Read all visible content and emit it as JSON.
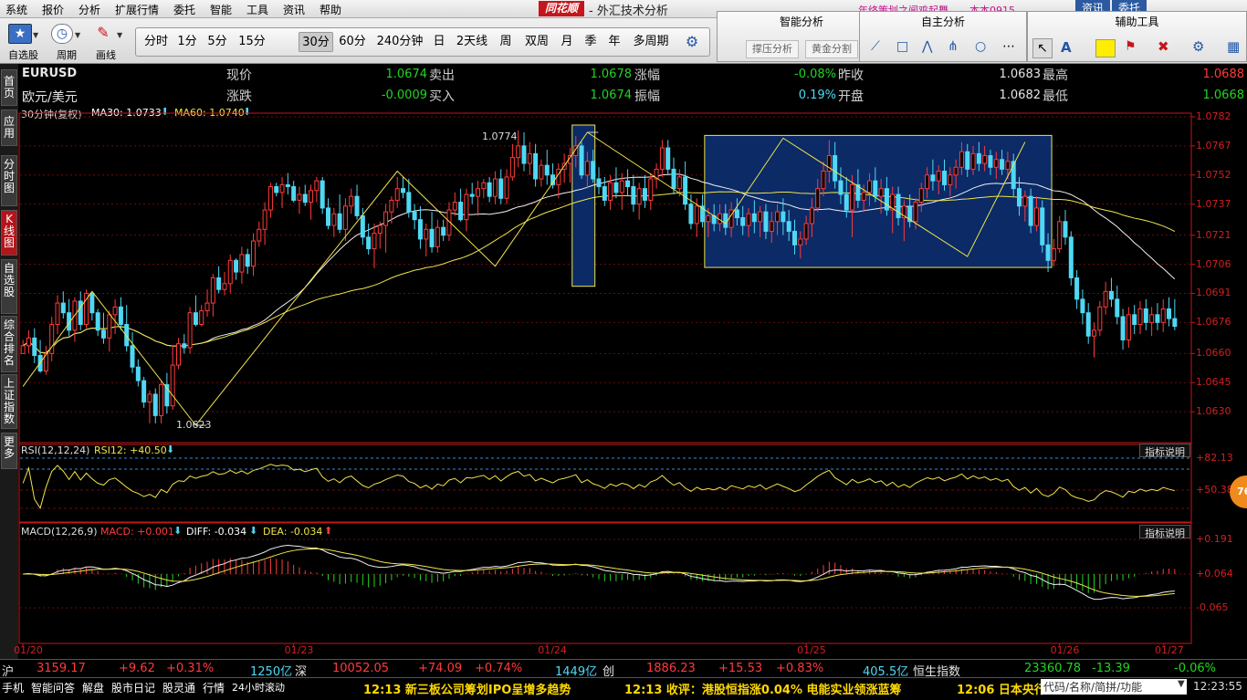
{
  "menubar": {
    "items": [
      "系统",
      "报价",
      "分析",
      "扩展行情",
      "委托",
      "智能",
      "工具",
      "资讯",
      "帮助"
    ],
    "logo": "同花顺",
    "title": "- 外汇技术分析",
    "marquee": "年终策划之闻鸡起舞",
    "user": "本本0915",
    "btn_news": "资讯",
    "btn_trade": "委托"
  },
  "toolbar": {
    "self_select": "自选股",
    "period": "周期",
    "draw": "画线",
    "periods": [
      "分时",
      "1分",
      "5分",
      "15分",
      "30分",
      "60分",
      "240分钟",
      "日",
      "2天线",
      "周",
      "双周",
      "月",
      "季",
      "年",
      "多周期"
    ],
    "selected_period": "30分"
  },
  "panels": {
    "smart": {
      "title": "智能分析",
      "btn1": "撑压分析",
      "btn2": "黄金分割"
    },
    "self": {
      "title": "自主分析"
    },
    "aux": {
      "title": "辅助工具"
    }
  },
  "sidebar": [
    "首页",
    "应用",
    "分时图",
    "K线图",
    "自选股",
    "综合排名",
    "上证指数",
    "更多"
  ],
  "quote": {
    "symbol": "EURUSD",
    "name": "欧元/美元",
    "xianjia_lbl": "现价",
    "xianjia": "1.0674",
    "zhangdie_lbl": "涨跌",
    "zhangdie": "-0.0009",
    "maichu_lbl": "卖出",
    "maichu": "1.0678",
    "mairu_lbl": "买入",
    "mairu": "1.0674",
    "zhangfu_lbl": "涨幅",
    "zhangfu": "-0.08%",
    "zhenfu_lbl": "振幅",
    "zhenfu": "0.19%",
    "zuoshou_lbl": "昨收",
    "zuoshou": "1.0683",
    "kaipan_lbl": "开盘",
    "kaipan": "1.0682",
    "zuigao_lbl": "最高",
    "zuigao": "1.0688",
    "zuidi_lbl": "最低",
    "zuidi": "1.0668"
  },
  "chart_header": {
    "period": "30分钟(复权)",
    "ma30": "MA30: 1.0733",
    "ma60": "MA60: 1.0740"
  },
  "rsi_header": {
    "label": "RSI(12,12,24)",
    "val": "RSI12: +40.50",
    "explain": "指标说明"
  },
  "macd_header": {
    "label": "MACD(12,26,9)",
    "macd": "MACD: +0.001",
    "diff": "DIFF: -0.034",
    "dea": "DEA: -0.034",
    "explain": "指标说明"
  },
  "annotations": {
    "high": "1.0774",
    "low": "1.0623"
  },
  "badge": "76",
  "chart_data": {
    "type": "candlestick",
    "price_axis": [
      "1.0782",
      "1.0767",
      "1.0752",
      "1.0737",
      "1.0721",
      "1.0706",
      "1.0691",
      "1.0676",
      "1.0660",
      "1.0645",
      "1.0630"
    ],
    "rsi_axis": [
      "+82.13",
      "+50.38"
    ],
    "macd_axis": [
      "+0.191",
      "+0.064",
      "-0.065"
    ],
    "dates": [
      "01/20",
      "01/23",
      "01/24",
      "01/25",
      "01/26",
      "01/27"
    ],
    "price_range": [
      1.0615,
      1.0782
    ],
    "macd_range": [
      -0.2,
      0.2
    ],
    "zigzag": [
      [
        0,
        1.0643
      ],
      [
        12,
        1.0692
      ],
      [
        30,
        1.0623
      ],
      [
        65,
        1.0754
      ],
      [
        82,
        1.0705
      ],
      [
        98,
        1.0774
      ],
      [
        122,
        1.0727
      ],
      [
        132,
        1.0771
      ],
      [
        164,
        1.071
      ],
      [
        174,
        1.0769
      ]
    ],
    "candles": [
      [
        1.066,
        1.0667,
        1.0663,
        1.0664
      ],
      [
        1.0664,
        1.0672,
        1.066,
        1.0668
      ],
      [
        1.0668,
        1.0673,
        1.0655,
        1.0659
      ],
      [
        1.0659,
        1.0667,
        1.065,
        1.0651
      ],
      [
        1.0651,
        1.0664,
        1.0649,
        1.066
      ],
      [
        1.066,
        1.0679,
        1.0656,
        1.0675
      ],
      [
        1.0675,
        1.069,
        1.067,
        1.0686
      ],
      [
        1.0686,
        1.0692,
        1.0678,
        1.0681
      ],
      [
        1.0681,
        1.0688,
        1.0669,
        1.0672
      ],
      [
        1.0672,
        1.0689,
        1.0666,
        1.0687
      ],
      [
        1.0687,
        1.0692,
        1.0672,
        1.0675
      ],
      [
        1.0675,
        1.0693,
        1.0673,
        1.0691
      ],
      [
        1.0691,
        1.0692,
        1.0677,
        1.0681
      ],
      [
        1.0681,
        1.0683,
        1.0669,
        1.0672
      ],
      [
        1.0672,
        1.0681,
        1.0665,
        1.0668
      ],
      [
        1.0668,
        1.0682,
        1.0661,
        1.068
      ],
      [
        1.068,
        1.0688,
        1.067,
        1.0684
      ],
      [
        1.0684,
        1.0689,
        1.0672,
        1.0675
      ],
      [
        1.0675,
        1.0685,
        1.0661,
        1.0664
      ],
      [
        1.0664,
        1.0671,
        1.065,
        1.0653
      ],
      [
        1.0653,
        1.0657,
        1.0643,
        1.0646
      ],
      [
        1.0646,
        1.0648,
        1.0632,
        1.0635
      ],
      [
        1.0635,
        1.0641,
        1.0624,
        1.0639
      ],
      [
        1.0639,
        1.0642,
        1.0624,
        1.0628
      ],
      [
        1.0628,
        1.0646,
        1.0624,
        1.0644
      ],
      [
        1.0644,
        1.065,
        1.0629,
        1.0633
      ],
      [
        1.0633,
        1.0664,
        1.0631,
        1.0654
      ],
      [
        1.0654,
        1.0668,
        1.0652,
        1.0665
      ],
      [
        1.0665,
        1.067,
        1.066,
        1.0663
      ],
      [
        1.0663,
        1.0684,
        1.066,
        1.0681
      ],
      [
        1.0681,
        1.069,
        1.0674,
        1.0675
      ],
      [
        1.0675,
        1.0685,
        1.0674,
        1.0682
      ],
      [
        1.0682,
        1.0693,
        1.0679,
        1.0686
      ],
      [
        1.0686,
        1.0701,
        1.0679,
        1.0699
      ],
      [
        1.0699,
        1.0705,
        1.0691,
        1.0693
      ],
      [
        1.0693,
        1.0702,
        1.069,
        1.0696
      ],
      [
        1.0696,
        1.0711,
        1.0691,
        1.0708
      ],
      [
        1.0708,
        1.0709,
        1.0698,
        1.0702
      ],
      [
        1.0702,
        1.0715,
        1.0696,
        1.0711
      ],
      [
        1.0711,
        1.0714,
        1.0701,
        1.0705
      ],
      [
        1.0705,
        1.0722,
        1.07,
        1.0718
      ],
      [
        1.0718,
        1.0728,
        1.0715,
        1.0724
      ],
      [
        1.0724,
        1.0738,
        1.0716,
        1.0734
      ],
      [
        1.0734,
        1.0748,
        1.073,
        1.0746
      ],
      [
        1.0746,
        1.0748,
        1.0741,
        1.0743
      ],
      [
        1.0743,
        1.0751,
        1.0735,
        1.0747
      ],
      [
        1.0747,
        1.0753,
        1.0742,
        1.0746
      ],
      [
        1.0746,
        1.0749,
        1.0738,
        1.0739
      ],
      [
        1.0739,
        1.0746,
        1.0732,
        1.0742
      ],
      [
        1.0742,
        1.0747,
        1.0736,
        1.0738
      ],
      [
        1.0738,
        1.0747,
        1.0729,
        1.0744
      ],
      [
        1.0744,
        1.0751,
        1.0738,
        1.0749
      ],
      [
        1.0749,
        1.0751,
        1.0732,
        1.0735
      ],
      [
        1.0735,
        1.074,
        1.0724,
        1.0726
      ],
      [
        1.0726,
        1.0735,
        1.072,
        1.0732
      ],
      [
        1.0732,
        1.0742,
        1.0722,
        1.0724
      ],
      [
        1.0724,
        1.074,
        1.0718,
        1.0736
      ],
      [
        1.0736,
        1.0745,
        1.0732,
        1.0741
      ],
      [
        1.0741,
        1.0747,
        1.0729,
        1.0731
      ],
      [
        1.0731,
        1.0735,
        1.0716,
        1.072
      ],
      [
        1.072,
        1.0727,
        1.0711,
        1.0714
      ],
      [
        1.0714,
        1.0727,
        1.0704,
        1.0722
      ],
      [
        1.0722,
        1.0728,
        1.0714,
        1.0726
      ],
      [
        1.0726,
        1.0737,
        1.0712,
        1.0733
      ],
      [
        1.0733,
        1.0741,
        1.0727,
        1.0739
      ],
      [
        1.0739,
        1.0751,
        1.0735,
        1.0745
      ],
      [
        1.0745,
        1.0751,
        1.074,
        1.0743
      ],
      [
        1.0743,
        1.075,
        1.073,
        1.0733
      ],
      [
        1.0733,
        1.0737,
        1.0724,
        1.0729
      ],
      [
        1.0729,
        1.0736,
        1.0714,
        1.0719
      ],
      [
        1.0719,
        1.0727,
        1.071,
        1.0724
      ],
      [
        1.0724,
        1.0733,
        1.0712,
        1.0715
      ],
      [
        1.0715,
        1.0729,
        1.0712,
        1.0725
      ],
      [
        1.0725,
        1.0729,
        1.0718,
        1.0721
      ],
      [
        1.0721,
        1.0738,
        1.0718,
        1.0734
      ],
      [
        1.0734,
        1.0743,
        1.0731,
        1.0738
      ],
      [
        1.0738,
        1.0745,
        1.0728,
        1.0729
      ],
      [
        1.0729,
        1.0745,
        1.0723,
        1.0742
      ],
      [
        1.0742,
        1.0748,
        1.0737,
        1.0741
      ],
      [
        1.0741,
        1.0749,
        1.0731,
        1.0745
      ],
      [
        1.0745,
        1.075,
        1.074,
        1.0748
      ],
      [
        1.0748,
        1.0751,
        1.0738,
        1.0741
      ],
      [
        1.0741,
        1.0754,
        1.0737,
        1.075
      ],
      [
        1.075,
        1.0755,
        1.0737,
        1.074
      ],
      [
        1.074,
        1.0755,
        1.0737,
        1.0751
      ],
      [
        1.0751,
        1.0768,
        1.0749,
        1.0761
      ],
      [
        1.0761,
        1.0775,
        1.0756,
        1.0767
      ],
      [
        1.0767,
        1.0774,
        1.0754,
        1.0758
      ],
      [
        1.0758,
        1.0769,
        1.0752,
        1.0763
      ],
      [
        1.0763,
        1.0768,
        1.0746,
        1.075
      ],
      [
        1.075,
        1.076,
        1.0746,
        1.0757
      ],
      [
        1.0757,
        1.0765,
        1.0747,
        1.0752
      ],
      [
        1.0752,
        1.0758,
        1.0745,
        1.0747
      ],
      [
        1.0747,
        1.0758,
        1.074,
        1.0755
      ],
      [
        1.0755,
        1.0763,
        1.0748,
        1.0758
      ],
      [
        1.0758,
        1.0766,
        1.0748,
        1.0762
      ],
      [
        1.0762,
        1.0772,
        1.0756,
        1.0767
      ],
      [
        1.0767,
        1.0769,
        1.075,
        1.0752
      ],
      [
        1.0752,
        1.0764,
        1.0745,
        1.0759
      ],
      [
        1.0759,
        1.0765,
        1.0748,
        1.075
      ],
      [
        1.075,
        1.0756,
        1.0742,
        1.0746
      ],
      [
        1.0746,
        1.0751,
        1.0736,
        1.0739
      ],
      [
        1.0739,
        1.0752,
        1.0734,
        1.0748
      ],
      [
        1.0748,
        1.0756,
        1.074,
        1.0743
      ],
      [
        1.0743,
        1.0753,
        1.0734,
        1.0749
      ],
      [
        1.0749,
        1.0755,
        1.0741,
        1.0746
      ],
      [
        1.0746,
        1.0752,
        1.0733,
        1.0737
      ],
      [
        1.0737,
        1.0748,
        1.0729,
        1.0745
      ],
      [
        1.0745,
        1.0752,
        1.0735,
        1.0739
      ],
      [
        1.0739,
        1.0753,
        1.0734,
        1.075
      ],
      [
        1.075,
        1.0758,
        1.0745,
        1.0755
      ],
      [
        1.0755,
        1.077,
        1.0751,
        1.0766
      ],
      [
        1.0766,
        1.077,
        1.0752,
        1.0755
      ],
      [
        1.0755,
        1.0761,
        1.0742,
        1.0745
      ],
      [
        1.0745,
        1.0755,
        1.0741,
        1.0751
      ],
      [
        1.0751,
        1.0759,
        1.0734,
        1.0737
      ],
      [
        1.0737,
        1.0742,
        1.0724,
        1.0727
      ],
      [
        1.0727,
        1.074,
        1.072,
        1.0736
      ],
      [
        1.0736,
        1.0742,
        1.0725,
        1.0728
      ],
      [
        1.0728,
        1.0735,
        1.072,
        1.0731
      ],
      [
        1.0731,
        1.0737,
        1.0723,
        1.0727
      ],
      [
        1.0727,
        1.0737,
        1.0723,
        1.0732
      ],
      [
        1.0732,
        1.0737,
        1.0721,
        1.0725
      ],
      [
        1.0725,
        1.0738,
        1.072,
        1.0734
      ],
      [
        1.0734,
        1.074,
        1.0726,
        1.073
      ],
      [
        1.073,
        1.0736,
        1.0721,
        1.0726
      ],
      [
        1.0726,
        1.0735,
        1.072,
        1.0732
      ],
      [
        1.0732,
        1.0739,
        1.0722,
        1.0728
      ],
      [
        1.0728,
        1.0736,
        1.072,
        1.0733
      ],
      [
        1.0733,
        1.0737,
        1.0719,
        1.0723
      ],
      [
        1.0723,
        1.0733,
        1.0717,
        1.0728
      ],
      [
        1.0728,
        1.0737,
        1.0721,
        1.0733
      ],
      [
        1.0733,
        1.074,
        1.0721,
        1.0728
      ],
      [
        1.0728,
        1.0734,
        1.0718,
        1.0723
      ],
      [
        1.0723,
        1.0729,
        1.0711,
        1.0716
      ],
      [
        1.0716,
        1.0723,
        1.0709,
        1.0719
      ],
      [
        1.0719,
        1.0731,
        1.0716,
        1.0727
      ],
      [
        1.0727,
        1.074,
        1.072,
        1.0735
      ],
      [
        1.0735,
        1.075,
        1.0733,
        1.0745
      ],
      [
        1.0745,
        1.0759,
        1.0741,
        1.0754
      ],
      [
        1.0754,
        1.077,
        1.0748,
        1.0762
      ],
      [
        1.0762,
        1.0769,
        1.0745,
        1.0749
      ],
      [
        1.0749,
        1.0756,
        1.0737,
        1.0742
      ],
      [
        1.0742,
        1.0751,
        1.073,
        1.0734
      ],
      [
        1.0734,
        1.0752,
        1.072,
        1.0747
      ],
      [
        1.0747,
        1.0755,
        1.0735,
        1.0739
      ],
      [
        1.0739,
        1.0747,
        1.0733,
        1.0743
      ],
      [
        1.0743,
        1.0753,
        1.0736,
        1.0749
      ],
      [
        1.0749,
        1.0756,
        1.0738,
        1.0741
      ],
      [
        1.0741,
        1.075,
        1.0732,
        1.0745
      ],
      [
        1.0745,
        1.0751,
        1.0731,
        1.0734
      ],
      [
        1.0734,
        1.0746,
        1.0722,
        1.0742
      ],
      [
        1.0742,
        1.0746,
        1.0726,
        1.073
      ],
      [
        1.073,
        1.0739,
        1.0718,
        1.0736
      ],
      [
        1.0736,
        1.0742,
        1.0725,
        1.0728
      ],
      [
        1.0728,
        1.074,
        1.0724,
        1.0738
      ],
      [
        1.0738,
        1.0748,
        1.0733,
        1.0745
      ],
      [
        1.0745,
        1.0756,
        1.074,
        1.0752
      ],
      [
        1.0752,
        1.076,
        1.0744,
        1.0749
      ],
      [
        1.0749,
        1.0757,
        1.0742,
        1.0754
      ],
      [
        1.0754,
        1.076,
        1.0744,
        1.0747
      ],
      [
        1.0747,
        1.0756,
        1.0741,
        1.0752
      ],
      [
        1.0752,
        1.076,
        1.0745,
        1.0756
      ],
      [
        1.0756,
        1.0769,
        1.0752,
        1.0764
      ],
      [
        1.0764,
        1.0768,
        1.0751,
        1.0755
      ],
      [
        1.0755,
        1.0767,
        1.0752,
        1.0763
      ],
      [
        1.0763,
        1.0769,
        1.0754,
        1.0758
      ],
      [
        1.0758,
        1.0767,
        1.0754,
        1.0762
      ],
      [
        1.0762,
        1.0765,
        1.0752,
        1.0756
      ],
      [
        1.0756,
        1.0764,
        1.075,
        1.076
      ],
      [
        1.076,
        1.0765,
        1.0752,
        1.0755
      ],
      [
        1.0755,
        1.0764,
        1.075,
        1.0759
      ],
      [
        1.0759,
        1.0763,
        1.0741,
        1.0745
      ],
      [
        1.0745,
        1.0751,
        1.0731,
        1.0736
      ],
      [
        1.0736,
        1.0744,
        1.0728,
        1.0741
      ],
      [
        1.0741,
        1.0745,
        1.0722,
        1.0726
      ],
      [
        1.0726,
        1.0741,
        1.0723,
        1.0735
      ],
      [
        1.0735,
        1.0739,
        1.0712,
        1.0716
      ],
      [
        1.0716,
        1.0722,
        1.0702,
        1.0708
      ],
      [
        1.0708,
        1.0719,
        1.0705,
        1.0714
      ],
      [
        1.0714,
        1.0731,
        1.0712,
        1.0728
      ],
      [
        1.0728,
        1.0734,
        1.0716,
        1.072
      ],
      [
        1.072,
        1.0723,
        1.0695,
        1.0699
      ],
      [
        1.0699,
        1.0703,
        1.0683,
        1.0688
      ],
      [
        1.0688,
        1.0693,
        1.0675,
        1.0681
      ],
      [
        1.0681,
        1.0686,
        1.0665,
        1.0669
      ],
      [
        1.0669,
        1.0676,
        1.0658,
        1.0672
      ],
      [
        1.0672,
        1.0687,
        1.0669,
        1.0684
      ],
      [
        1.0684,
        1.0697,
        1.068,
        1.0692
      ],
      [
        1.0692,
        1.0699,
        1.0684,
        1.0688
      ],
      [
        1.0688,
        1.0695,
        1.0675,
        1.0679
      ],
      [
        1.0679,
        1.0683,
        1.0662,
        1.0667
      ],
      [
        1.0667,
        1.0684,
        1.0663,
        1.068
      ],
      [
        1.068,
        1.0685,
        1.067,
        1.0675
      ],
      [
        1.0675,
        1.0687,
        1.067,
        1.0683
      ],
      [
        1.0683,
        1.0688,
        1.0672,
        1.0676
      ],
      [
        1.0676,
        1.0684,
        1.0669,
        1.068
      ],
      [
        1.068,
        1.0686,
        1.0672,
        1.0676
      ],
      [
        1.0676,
        1.0688,
        1.0671,
        1.0683
      ],
      [
        1.0683,
        1.0689,
        1.0674,
        1.0678
      ],
      [
        1.0678,
        1.0688,
        1.0672,
        1.0674
      ]
    ]
  },
  "statusbar": {
    "sh_lbl": "沪",
    "sh": "3159.17",
    "sh_chg": "+9.62",
    "sh_pct": "+0.31%",
    "sh_amt": "1250亿",
    "sz_lbl": "深",
    "sz": "10052.05",
    "sz_chg": "+74.09",
    "sz_pct": "+0.74%",
    "sz_amt": "1449亿",
    "cy_lbl": "创",
    "cy": "1886.23",
    "cy_chg": "+15.53",
    "cy_pct": "+0.83%",
    "cy_amt": "405.5亿",
    "hs_lbl": "恒生指数",
    "hs": "23360.78",
    "hs_chg": "-13.39",
    "hs_pct": "-0.06%"
  },
  "bottombar": {
    "items": [
      "手机",
      "智能问答",
      "解盘",
      "股市日记",
      "股灵通",
      "行情",
      "24小时滚动"
    ],
    "news1": "12:13 新三板公司筹划IPO呈增多趋势",
    "news2": "12:13 收评：港股恒指涨0.04% 电能实业领涨蓝筹",
    "news3": "12:06 日本央行",
    "search": "代码/名称/简拼/功能",
    "time": "12:23:55"
  },
  "colors": {
    "up": "#ff3b3b",
    "down": "#4fd8f4",
    "ma": "#f0f0f0",
    "ma60": "#f0e44a",
    "box": "#0a2a6a",
    "frame": "#c01818"
  }
}
